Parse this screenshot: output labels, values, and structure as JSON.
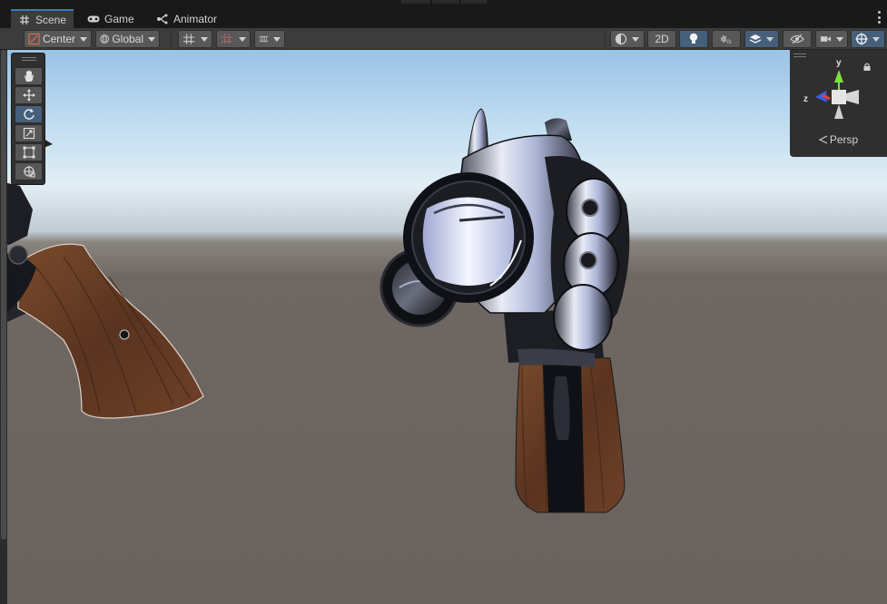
{
  "tabs": [
    {
      "label": "Scene",
      "icon": "grid-icon",
      "active": true
    },
    {
      "label": "Game",
      "icon": "gamepad-icon",
      "active": false
    },
    {
      "label": "Animator",
      "icon": "animator-icon",
      "active": false
    }
  ],
  "toolbar": {
    "pivot_label": "Center",
    "space_label": "Global",
    "mode_2d_label": "2D"
  },
  "gizmo": {
    "y_label": "y",
    "z_label": "z",
    "projection_label": "Persp"
  },
  "tools": [
    "hand-tool",
    "move-tool",
    "rotate-tool",
    "scale-tool",
    "rect-tool",
    "transform-tool"
  ],
  "selected_tool": "rotate-tool",
  "colors": {
    "accent": "#3a79bb",
    "toolbar_bg": "#3c3c3c",
    "button_bg": "#585858",
    "button_on": "#46607c",
    "sky_top": "#9ac3e6",
    "ground": "#6a625e"
  }
}
